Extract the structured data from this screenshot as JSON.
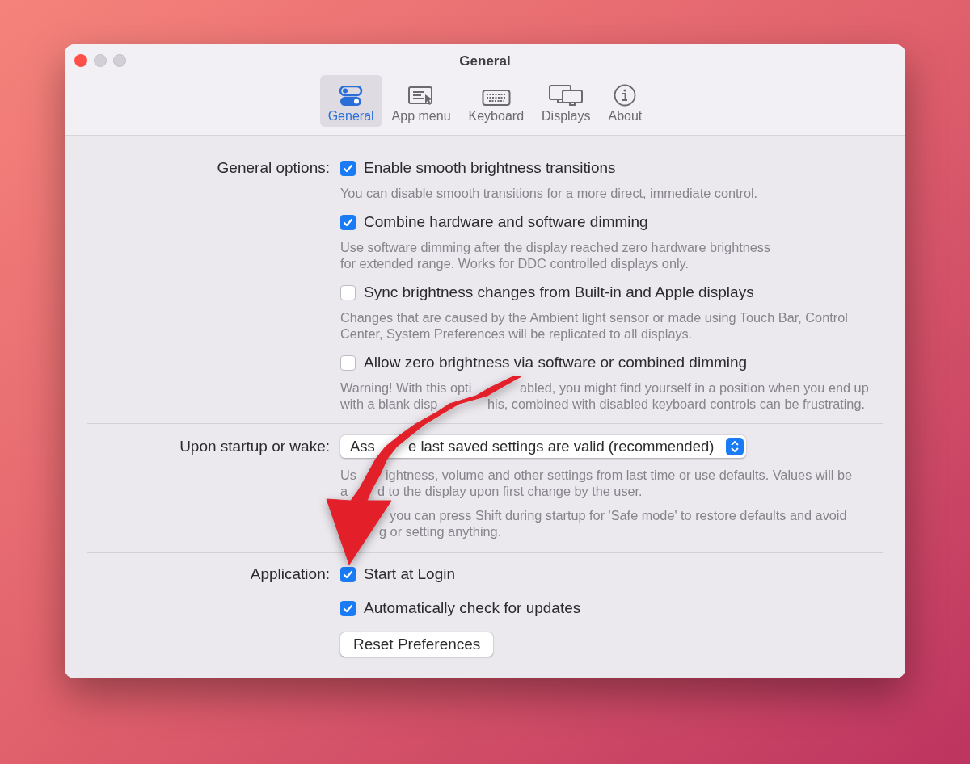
{
  "window": {
    "title": "General"
  },
  "tabs": [
    {
      "label": "General",
      "selected": true
    },
    {
      "label": "App menu",
      "selected": false
    },
    {
      "label": "Keyboard",
      "selected": false
    },
    {
      "label": "Displays",
      "selected": false
    },
    {
      "label": "About",
      "selected": false
    }
  ],
  "sections": [
    {
      "label": "General options:",
      "items": [
        {
          "kind": "checkbox",
          "label": "Enable smooth brightness transitions",
          "checked": true,
          "description": [
            {
              "before": "You can disable smooth transitions for a more direct, immediate control."
            }
          ]
        },
        {
          "kind": "checkbox",
          "label": "Combine hardware and software dimming",
          "checked": true,
          "description": [
            {
              "before": "Use software dimming after the display reached zero hardware brightness"
            },
            {
              "before": "for extended range. Works for DDC controlled displays only."
            }
          ]
        },
        {
          "kind": "checkbox",
          "label": "Sync brightness changes from Built-in and Apple displays",
          "checked": false,
          "description": [
            {
              "before": "Changes that are caused by the Ambient light sensor or made using Touch Bar, Control"
            },
            {
              "before": "Center, System Preferences will be replicated to all displays."
            }
          ]
        },
        {
          "kind": "checkbox",
          "label": "Allow zero brightness via software or combined dimming",
          "checked": false,
          "description": [
            {
              "before": "Warning! With this opti",
              "after": "abled, you might find yourself in a position when you end up"
            },
            {
              "before": "with a blank disp",
              "after": "his, combined with disabled keyboard controls can be frustrating."
            }
          ]
        }
      ]
    },
    {
      "label": "Upon startup or wake:",
      "items": [
        {
          "kind": "select",
          "value": {
            "before": "Ass",
            "after": "e last saved settings are valid (recommended)"
          },
          "description": [
            {
              "before": "Us",
              "after": "ightness, volume and other settings from last time or use defaults. Values will be"
            },
            {
              "before": "a",
              "after": "d to the display upon first change by the user."
            }
          ],
          "note": [
            {
              "after": "you can press Shift during startup for 'Safe mode' to restore defaults and avoid"
            },
            {
              "after": "g or setting anything."
            }
          ]
        }
      ]
    },
    {
      "label": "Application:",
      "items": [
        {
          "kind": "checkbox",
          "label": "Start at Login",
          "checked": true
        },
        {
          "kind": "checkbox",
          "label": "Automatically check for updates",
          "checked": true
        },
        {
          "kind": "button",
          "label": "Reset Preferences"
        }
      ]
    }
  ]
}
